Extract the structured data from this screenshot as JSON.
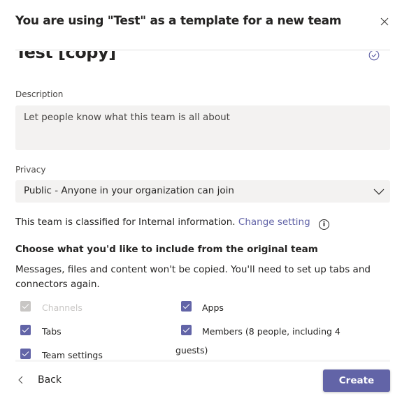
{
  "dialog": {
    "title": "You are using \"Test\" as a template for a new team",
    "close_icon": "close-icon"
  },
  "team_name": {
    "value": "Test [copy]",
    "status_icon": "check-circle-icon"
  },
  "description": {
    "label": "Description",
    "placeholder": "Let people know what this team is all about"
  },
  "privacy": {
    "label": "Privacy",
    "value": "Public - Anyone in your organization can join"
  },
  "classification": {
    "text": "This team is classified for Internal information.",
    "link": "Change setting",
    "icon": "info-icon"
  },
  "include": {
    "heading": "Choose what you'd like to include from the original team",
    "note": "Messages, files and content won't be copied. You'll need to set up tabs and connectors again.",
    "options": [
      {
        "label": "Channels",
        "checked": true,
        "disabled": true
      },
      {
        "label": "Apps",
        "checked": true,
        "disabled": false
      },
      {
        "label": "Tabs",
        "checked": true,
        "disabled": false
      },
      {
        "label": "Members (8 people, including 4",
        "checked": true,
        "disabled": false
      },
      {
        "label": "Team settings",
        "checked": true,
        "disabled": false
      }
    ],
    "members_wrap": "guests)"
  },
  "footer": {
    "back": "Back",
    "create": "Create"
  },
  "colors": {
    "accent": "#6264a7",
    "disabled": "#c8c6c4",
    "field_bg": "#f3f2f1"
  }
}
